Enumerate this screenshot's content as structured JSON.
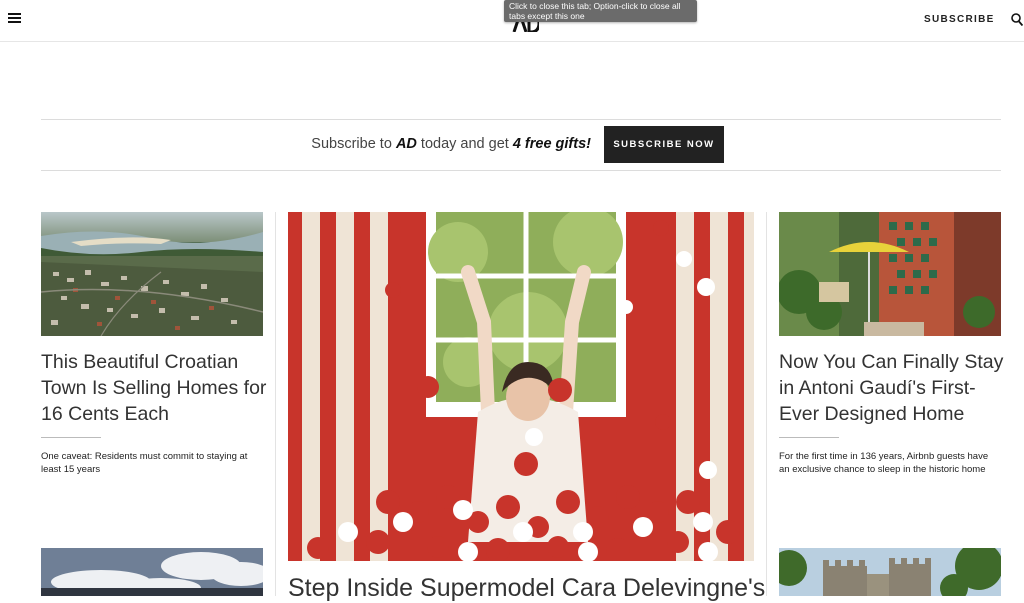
{
  "header": {
    "subscribe_label": "SUBSCRIBE",
    "tooltip_line1": "Click to close this tab; Option-click to close all",
    "tooltip_line2": "tabs except this one"
  },
  "banner": {
    "text_prefix": "Subscribe to ",
    "brand": "AD",
    "text_middle": " today and get ",
    "offer": "4 free gifts!",
    "button_label": "SUBSCRIBE NOW"
  },
  "articles": [
    {
      "title": "This Beautiful Croatian Town Is Selling Homes for 16 Cents Each",
      "dek": "One caveat: Residents must commit to staying at least 15 years"
    },
    {
      "title": "Step Inside Supermodel Cara Delevingne's"
    },
    {
      "title": "Now You Can Finally Stay in Antoni Gaudí's First-Ever Designed Home",
      "dek": "For the first time in 136 years, Airbnb guests have an exclusive chance to sleep in the historic home"
    }
  ],
  "colors": {
    "accent_red": "#c8342b",
    "button_dark": "#222222",
    "tooltip_gray": "#6b6b6b"
  },
  "icons": [
    "menu-icon",
    "logo-icon",
    "search-icon"
  ]
}
